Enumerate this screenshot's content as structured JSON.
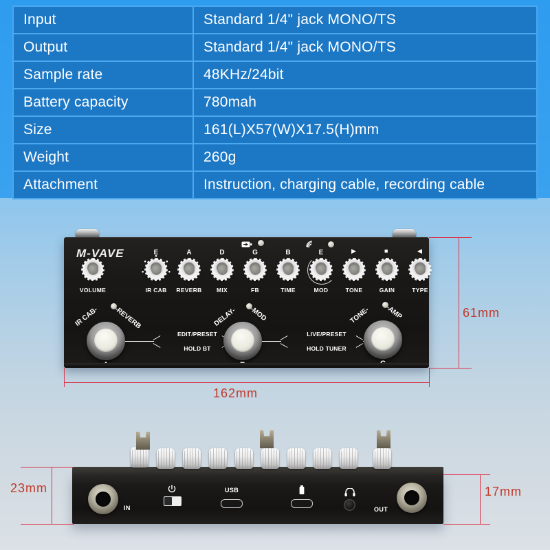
{
  "spec_table": {
    "rows": [
      {
        "key": "Input",
        "value": "Standard 1/4\" jack MONO/TS"
      },
      {
        "key": "Output",
        "value": "Standard 1/4\" jack MONO/TS"
      },
      {
        "key": "Sample rate",
        "value": "48KHz/24bit"
      },
      {
        "key": "Battery capacity",
        "value": "780mah"
      },
      {
        "key": "Size",
        "value": "161(L)X57(W)X17.5(H)mm"
      },
      {
        "key": "Weight",
        "value": "260g"
      },
      {
        "key": "Attachment",
        "value": "Instruction, charging cable, recording cable"
      }
    ]
  },
  "top_view": {
    "brand": "M-VAVE",
    "knobs": [
      {
        "label": "VOLUME",
        "note": ""
      },
      {
        "label": "IR CAB",
        "note": "E"
      },
      {
        "label": "REVERB",
        "note": "A"
      },
      {
        "label": "MIX",
        "note": "D"
      },
      {
        "label": "FB",
        "note": "G"
      },
      {
        "label": "TIME",
        "note": "B"
      },
      {
        "label": "MOD",
        "note": "E"
      },
      {
        "label": "TONE",
        "note": ""
      },
      {
        "label": "GAIN",
        "note": ""
      },
      {
        "label": "TYPE",
        "note": ""
      }
    ],
    "icons": {
      "battery": "battery-icon",
      "bluetooth": "bluetooth-icon",
      "play": "▶",
      "stop": "■",
      "back": "◀"
    },
    "footswitches": [
      {
        "letter": "A",
        "arc_left": "IR CAB-",
        "arc_right": "-REVERB"
      },
      {
        "letter": "B",
        "arc_left": "DELAY-",
        "arc_right": "-MOD"
      },
      {
        "letter": "C",
        "arc_left": "TONE-",
        "arc_right": "-AMP"
      }
    ],
    "between_ab": {
      "top": "EDIT/PRESET",
      "bottom": "HOLD BT"
    },
    "between_bc": {
      "top": "LIVE/PRESET",
      "bottom": "HOLD TUNER"
    }
  },
  "rear_view": {
    "in_label": "IN",
    "out_label": "OUT",
    "usb_label": "USB",
    "power_icon": "⏻",
    "battery_icon": "battery-icon",
    "headphone_icon": "◠"
  },
  "dimensions": {
    "width": "162mm",
    "depth": "61mm",
    "height_left": "23mm",
    "height_right": "17mm"
  },
  "colors": {
    "table_cell": "#1c77c4",
    "table_grid": "#4aa8ee",
    "dimension": "#c0392b",
    "background_top": "#2f9ef0",
    "background_bottom": "#dbe1e6"
  }
}
